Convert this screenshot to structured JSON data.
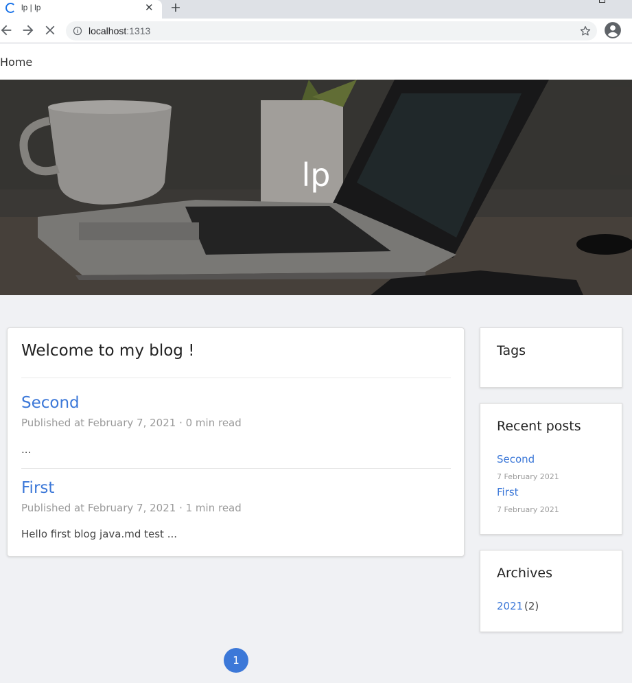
{
  "browser": {
    "tab_title": "lp | lp",
    "tab_close": "✕",
    "new_tab": "+",
    "url_host": "localhost",
    "url_port": ":1313"
  },
  "site": {
    "nav": {
      "home": "Home"
    },
    "hero_title": "lp"
  },
  "main": {
    "heading": "Welcome to my blog !",
    "posts": [
      {
        "title": "Second",
        "meta": "Published at February 7, 2021 ·  0 min read",
        "excerpt": "..."
      },
      {
        "title": "First",
        "meta": "Published at February 7, 2021 ·  1 min read",
        "excerpt": "Hello first blog java.md test ..."
      }
    ]
  },
  "sidebar": {
    "tags": {
      "title": "Tags"
    },
    "recent": {
      "title": "Recent posts",
      "items": [
        {
          "title": "Second",
          "date": "7 February 2021"
        },
        {
          "title": "First",
          "date": "7 February 2021"
        }
      ]
    },
    "archives": {
      "title": "Archives",
      "items": [
        {
          "year": "2021",
          "count": "(2)"
        }
      ]
    }
  },
  "pagination": {
    "current": "1"
  },
  "colors": {
    "link": "#3c78d8",
    "page_bg": "#f0f1f4",
    "accent": "#1a73e8"
  }
}
